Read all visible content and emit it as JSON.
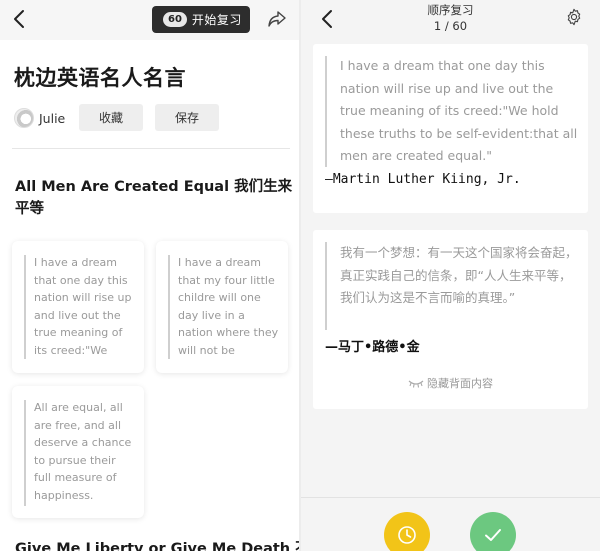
{
  "left": {
    "review_count": "60",
    "review_label": "开始复习",
    "title": "枕边英语名人名言",
    "user_name": "Julie",
    "favorite_label": "收藏",
    "save_label": "保存",
    "section1_title": "All Men Are Created Equal 我们生来平等",
    "cards": [
      {
        "text": "I have a dream that one day this nation will rise up and live out the true meaning of its creed:\"We"
      },
      {
        "text": "I have a dream that my four little childre will one day live in a nation where they will not be"
      },
      {
        "text": "All are equal, all are free, and all deserve a chance to pursue their full measure of happiness."
      }
    ],
    "section2_title": "Give Me Liberty or Give Me Death 不"
  },
  "right": {
    "title": "顺序复习",
    "counter": "1 / 60",
    "front_quote": "I have a dream that one day this nation will rise up and live out the true meaning of its creed:\"We hold these truths to be self-evident:that all men are created equal.\"",
    "front_author": "—Martin Luther Kiing, Jr.",
    "back_quote": "我有一个梦想：有一天这个国家将会奋起，真正实践自己的信条，即“人人生来平等，我们认为这是不言而喻的真理。”",
    "back_author": "—马丁•路德•金",
    "hide_label": "隐藏背面内容"
  },
  "colors": {
    "clock_button": "#f2c418",
    "check_button": "#6cc880",
    "review_button": "#2d2d2d"
  }
}
